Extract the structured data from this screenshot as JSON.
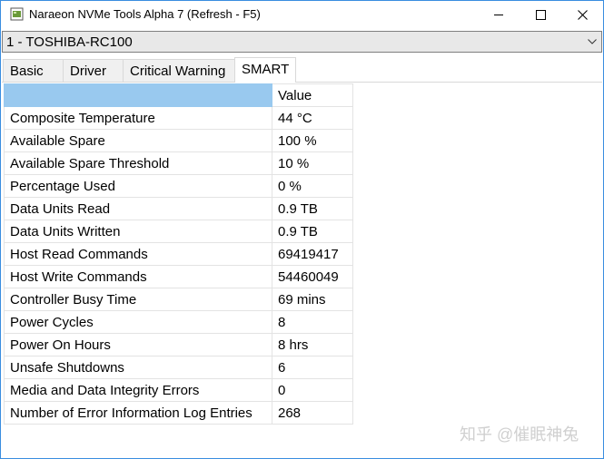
{
  "window": {
    "title": "Naraeon NVMe Tools Alpha 7 (Refresh - F5)"
  },
  "device_select": {
    "value": "1 - TOSHIBA-RC100"
  },
  "tabs": [
    {
      "label": "Basic"
    },
    {
      "label": "Driver"
    },
    {
      "label": "Critical Warning"
    },
    {
      "label": "SMART"
    }
  ],
  "grid": {
    "header_value": "Value",
    "rows": [
      {
        "name": "Composite Temperature",
        "value": "44 °C"
      },
      {
        "name": "Available Spare",
        "value": "100 %"
      },
      {
        "name": "Available Spare Threshold",
        "value": "10 %"
      },
      {
        "name": "Percentage Used",
        "value": "0 %"
      },
      {
        "name": "Data Units Read",
        "value": "0.9 TB"
      },
      {
        "name": "Data Units Written",
        "value": "0.9 TB"
      },
      {
        "name": "Host Read Commands",
        "value": "69419417"
      },
      {
        "name": "Host Write Commands",
        "value": "54460049"
      },
      {
        "name": "Controller Busy Time",
        "value": "69 mins"
      },
      {
        "name": "Power Cycles",
        "value": "8"
      },
      {
        "name": "Power On Hours",
        "value": "8 hrs"
      },
      {
        "name": "Unsafe Shutdowns",
        "value": "6"
      },
      {
        "name": "Media and Data Integrity Errors",
        "value": "0"
      },
      {
        "name": "Number of Error Information Log Entries",
        "value": "268"
      }
    ]
  },
  "watermark": "知乎 @催眠神兔",
  "colors": {
    "window_border": "#3a8de0",
    "header_selection": "#99c9ef",
    "tab_inactive": "#f0f0f0"
  },
  "icons": {
    "app": "app-icon",
    "minimize": "minimize-icon",
    "maximize": "maximize-icon",
    "close": "close-icon",
    "dropdown": "chevron-down-icon"
  }
}
